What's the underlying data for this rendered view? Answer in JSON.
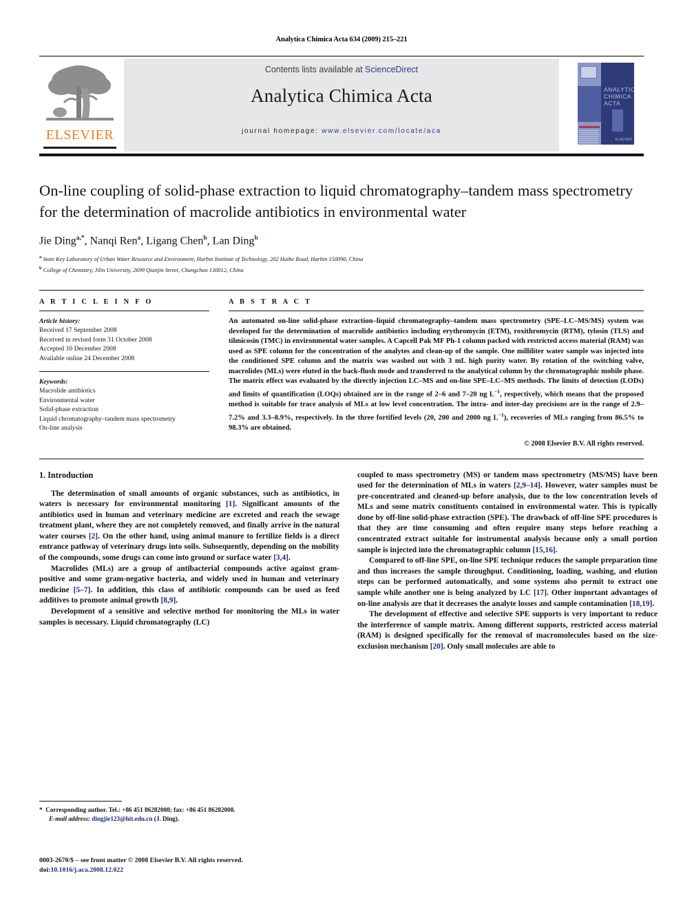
{
  "running_head": "Analytica Chimica Acta 634 (2009) 215–221",
  "masthead": {
    "contents_prefix": "Contents lists available at ",
    "sciencedirect": "ScienceDirect",
    "journal_title": "Analytica Chimica Acta",
    "homepage_label": "journal homepage: ",
    "homepage_url": "www.elsevier.com/locate/aca",
    "publisher_wordmark": "ELSEVIER",
    "publisher_color": "#F47B20",
    "cover_title_line1": "ANALYTICA",
    "cover_title_line2": "CHIMICA ACTA",
    "cover_footer": "ELSEVIER"
  },
  "article": {
    "title": "On-line coupling of solid-phase extraction to liquid chromatography–tandem mass spectrometry for the determination of macrolide antibiotics in environmental water",
    "authors": [
      {
        "name": "Jie Ding",
        "marks": "a,*"
      },
      {
        "name": "Nanqi Ren",
        "marks": "a"
      },
      {
        "name": "Ligang Chen",
        "marks": "b"
      },
      {
        "name": "Lan Ding",
        "marks": "b"
      }
    ],
    "affiliations": [
      {
        "mark": "a",
        "text": "State Key Laboratory of Urban Water Resource and Environment, Harbin Institute of Technology, 202 Haihe Road, Harbin 150090, China"
      },
      {
        "mark": "b",
        "text": "College of Chemistry, Jilin University, 2699 Qianjin Street, Changchun 130012, China"
      }
    ]
  },
  "article_info": {
    "heading": "A R T I C L E   I N F O",
    "history_label": "Article history:",
    "history": [
      "Received 17 September 2008",
      "Received in revised form 31 October 2008",
      "Accepted 10 December 2008",
      "Available online 24 December 2008"
    ],
    "keywords_label": "Keywords:",
    "keywords": [
      "Macrolide antibiotics",
      "Environmental water",
      "Solid-phase extraction",
      "Liquid chromatography–tandem mass spectrometry",
      "On-line analysis"
    ]
  },
  "abstract": {
    "heading": "A B S T R A C T",
    "text_part1": "An automated on-line solid-phase extraction–liquid chromatography–tandem mass spectrometry (SPE–LC–MS/MS) system was developed for the determination of macrolide antibiotics including erythromycin (ETM), roxithromycin (RTM), tylosin (TLS) and tilmicosin (TMC) in environmental water samples. A Capcell Pak MF Ph-1 column packed with restricted access material (RAM) was used as SPE column for the concentration of the analytes and clean-up of the sample. One milliliter water sample was injected into the conditioned SPE column and the matrix was washed out with 3 mL high purity water. By rotation of the switching valve, macrolides (MLs) were eluted in the back-flush mode and transferred to the analytical column by the chromatographic mobile phase. The matrix effect was evaluated by the directly injection LC–MS and on-line SPE–LC–MS methods. The limits of detection (LODs) and limits of quantification (LOQs) obtained are in the range of 2–6 and 7–20 ng L",
    "sup1": "−1",
    "text_part2": ", respectively, which means that the proposed method is suitable for trace analysis of MLs at low level concentration. The intra- and inter-day precisions are in the range of 2.9–7.2% and 3.3–8.9%, respectively. In the three fortified levels (20, 200 and 2000 ng L",
    "sup2": "−1",
    "text_part3": "), recoveries of MLs ranging from 86.5% to 98.3% are obtained.",
    "copyright": "© 2008 Elsevier B.V. All rights reserved."
  },
  "body": {
    "section_title": "1.  Introduction",
    "left_paragraphs": [
      {
        "p1": "The determination of small amounts of organic substances, such as antibiotics, in waters is necessary for environmental monitoring ",
        "r1": "[1]",
        "p2": ". Significant amounts of the antibiotics used in human and veterinary medicine are excreted and reach the sewage treatment plant, where they are not completely removed, and finally arrive in the natural water courses ",
        "r2": "[2]",
        "p3": ". On the other hand, using animal manure to fertilize fields is a direct entrance pathway of veterinary drugs into soils. Subsequently, depending on the mobility of the compounds, some drugs can come into ground or surface water ",
        "r3": "[3,4]",
        "p4": "."
      },
      {
        "p1": "Macrolides (MLs) are a group of antibacterial compounds active against gram-positive and some gram-negative bacteria, and widely used in human and veterinary medicine ",
        "r1": "[5–7]",
        "p2": ". In addition, this class of antibiotic compounds can be used as feed additives to promote animal growth ",
        "r2": "[8,9]",
        "p3": "."
      },
      {
        "p1": "Development of a sensitive and selective method for monitoring the MLs in water samples is necessary. Liquid chromatography (LC)",
        "r1": "",
        "p2": ""
      }
    ],
    "right_paragraphs": [
      {
        "p1": "coupled to mass spectrometry (MS) or tandem mass spectrometry (MS/MS) have been used for the determination of MLs in waters ",
        "r1": "[2,9–14]",
        "p2": ". However, water samples must be pre-concentrated and cleaned-up before analysis, due to the low concentration levels of MLs and some matrix constituents contained in environmental water. This is typically done by off-line solid-phase extraction (SPE). The drawback of off-line SPE procedures is that they are time consuming and often require many steps before reaching a concentrated extract suitable for instrumental analysis because only a small portion sample is injected into the chromatographic column ",
        "r2": "[15,16]",
        "p3": "."
      },
      {
        "p1": "Compared to off-line SPE, on-line SPE technique reduces the sample preparation time and thus increases the sample throughput. Conditioning, loading, washing, and elution steps can be performed automatically, and some systems also permit to extract one sample while another one is being analyzed by LC ",
        "r1": "[17]",
        "p2": ". Other important advantages of on-line analysis are that it decreases the analyte losses and sample contamination ",
        "r2": "[18,19]",
        "p3": "."
      },
      {
        "p1": "The development of effective and selective SPE supports is very important to reduce the interference of sample matrix. Among different supports, restricted access material (RAM) is designed specifically for the removal of macromolecules based on the size-exclusion mechanism ",
        "r1": "[20]",
        "p2": ". Only small molecules are able to",
        "p3": ""
      }
    ]
  },
  "footnote": {
    "star": "*",
    "corresponding": "Corresponding author. Tel.: +86 451 86282008; fax: +86 451 86282008.",
    "email_label": "E-mail address:",
    "email": "dingjie123@hit.edu.cn",
    "email_suffix": " (J. Ding)."
  },
  "imprint": {
    "line1": "0003-2670/$ – see front matter © 2008 Elsevier B.V. All rights reserved.",
    "doi_label": "doi:",
    "doi": "10.1016/j.aca.2008.12.022"
  }
}
